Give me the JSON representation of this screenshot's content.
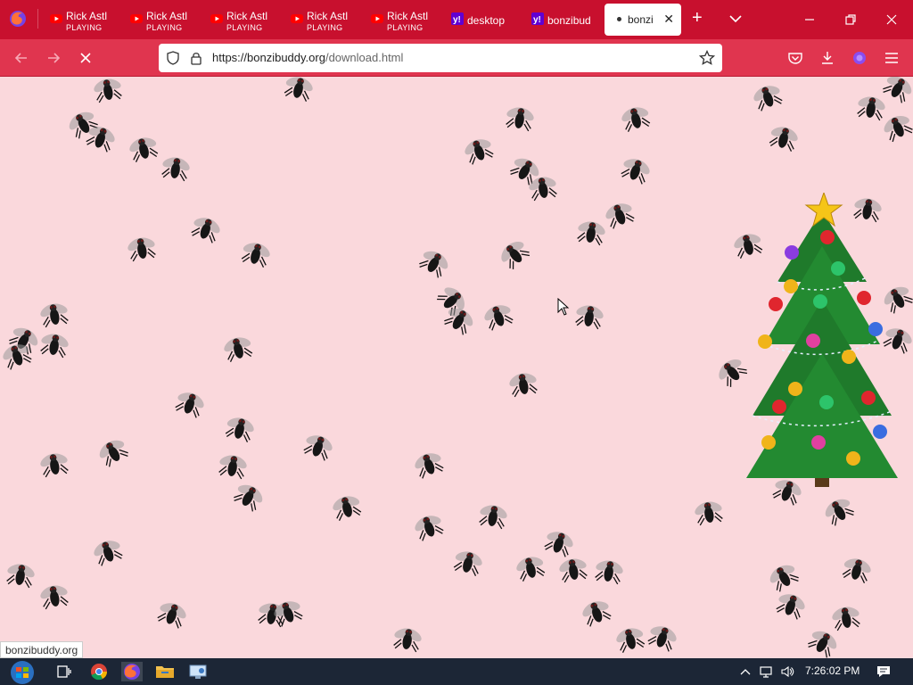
{
  "browser": {
    "tabs": [
      {
        "title": "Rick Astl",
        "subtitle": "PLAYING",
        "icon": "youtube-icon"
      },
      {
        "title": "Rick Astl",
        "subtitle": "PLAYING",
        "icon": "youtube-icon"
      },
      {
        "title": "Rick Astl",
        "subtitle": "PLAYING",
        "icon": "youtube-icon"
      },
      {
        "title": "Rick Astl",
        "subtitle": "PLAYING",
        "icon": "youtube-icon"
      },
      {
        "title": "Rick Astl",
        "subtitle": "PLAYING",
        "icon": "youtube-icon"
      },
      {
        "title": "desktop",
        "subtitle": "",
        "icon": "yahoo-icon"
      },
      {
        "title": "bonzibud",
        "subtitle": "",
        "icon": "yahoo-icon"
      },
      {
        "title": "bonzi",
        "subtitle": "",
        "icon": "loading-dot-icon",
        "active": true
      }
    ],
    "new_tab_label": "+",
    "url_host": "https://bonzibuddy.org",
    "url_path": "/download.html"
  },
  "status_text": "bonzibuddy.org",
  "taskbar": {
    "clock": "7:26:02 PM",
    "apps": [
      "task-view-icon",
      "chrome-icon",
      "firefox-icon",
      "file-explorer-icon",
      "remote-desktop-icon"
    ]
  },
  "colors": {
    "tabstrip": "#c8102e",
    "navbar": "#e0354f",
    "page_background": "#fad8dc",
    "taskbar": "#1c2636"
  }
}
